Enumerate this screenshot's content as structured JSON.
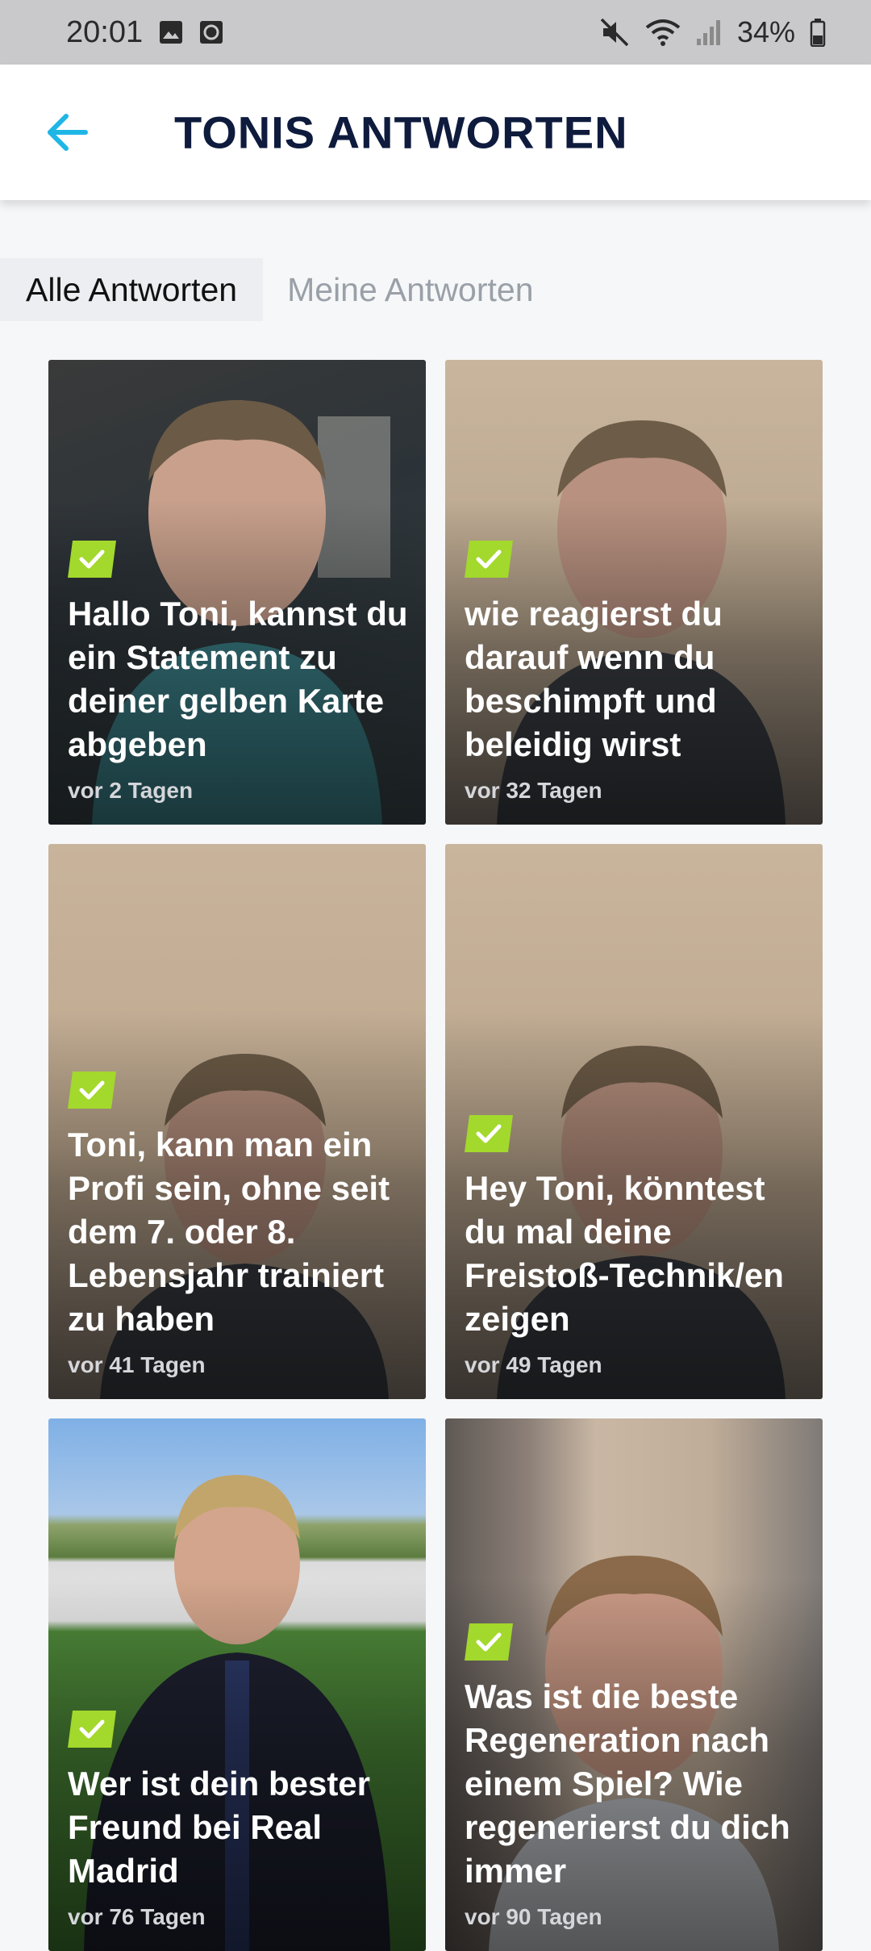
{
  "status_bar": {
    "time": "20:01",
    "battery": "34%"
  },
  "app_bar": {
    "title": "TONIS ANTWORTEN"
  },
  "tabs": [
    {
      "label": "Alle Antworten",
      "active": true
    },
    {
      "label": "Meine Antworten",
      "active": false
    }
  ],
  "cards": [
    {
      "question": "Hallo Toni, kannst du ein Statement zu deiner gelben Karte abgeben",
      "time": "vor 2 Tagen"
    },
    {
      "question": "wie reagierst du darauf wenn du beschimpft und beleidig wirst",
      "time": "vor 32 Tagen"
    },
    {
      "question": "Toni, kann man ein Profi sein, ohne seit dem 7. oder 8. Lebensjahr trainiert zu haben",
      "time": "vor 41 Tagen"
    },
    {
      "question": "Hey Toni, könntest du mal deine Freistoß-Technik/en zeigen",
      "time": "vor 49 Tagen"
    },
    {
      "question": "Wer ist dein bester Freund bei Real Madrid",
      "time": "vor 76 Tagen"
    },
    {
      "question": "Was ist die beste Regeneration  nach einem Spiel? Wie regenerierst du dich immer",
      "time": "vor 90 Tagen"
    }
  ],
  "colors": {
    "accent": "#1fb6e6",
    "title": "#0e1b3d",
    "badge": "#a3d82c"
  }
}
